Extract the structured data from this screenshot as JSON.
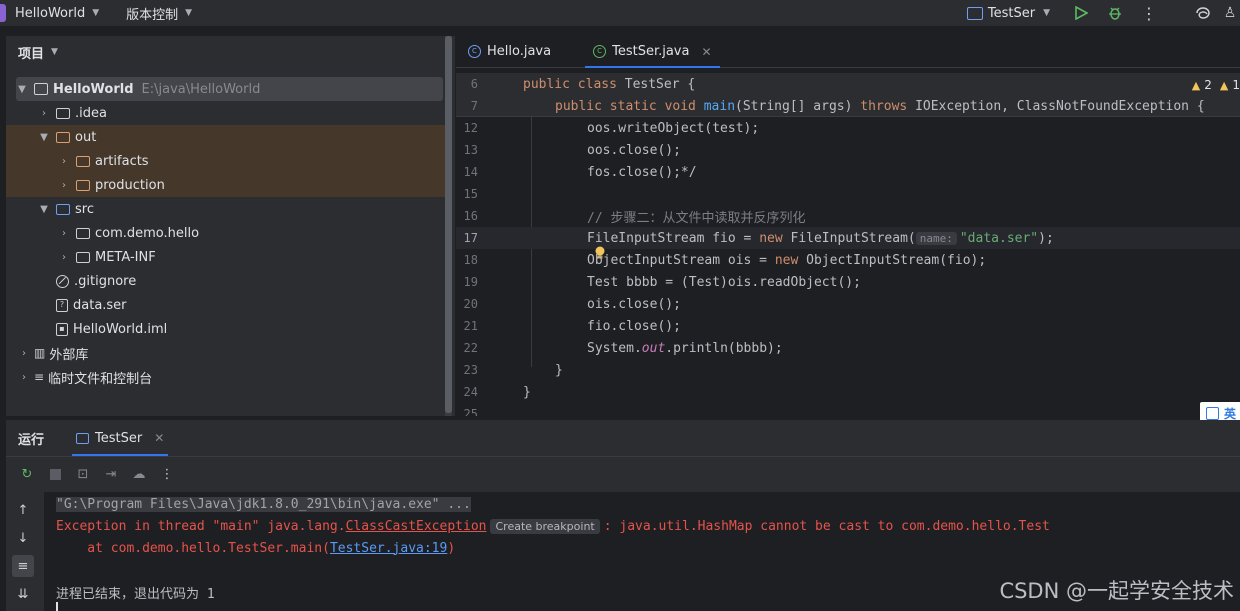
{
  "titlebar": {
    "project_name": "HelloWorld",
    "vcs_menu": "版本控制",
    "run_config": "TestSer"
  },
  "project": {
    "header": "项目",
    "tree": [
      {
        "label": "HelloWorld",
        "path": "E:\\java\\HelloWorld",
        "depth": 0,
        "expanded": true,
        "icon": "module-icon"
      },
      {
        "label": ".idea",
        "depth": 1,
        "expanded": false,
        "icon": "folder-icon"
      },
      {
        "label": "out",
        "depth": 1,
        "expanded": true,
        "icon": "folder-icon"
      },
      {
        "label": "artifacts",
        "depth": 2,
        "expanded": false,
        "icon": "folder-icon"
      },
      {
        "label": "production",
        "depth": 2,
        "expanded": false,
        "icon": "folder-icon"
      },
      {
        "label": "src",
        "depth": 1,
        "expanded": true,
        "icon": "source-folder-icon"
      },
      {
        "label": "com.demo.hello",
        "depth": 2,
        "expanded": false,
        "icon": "package-icon"
      },
      {
        "label": "META-INF",
        "depth": 2,
        "expanded": false,
        "icon": "folder-icon"
      },
      {
        "label": ".gitignore",
        "depth": 1,
        "icon": "ignore-file-icon"
      },
      {
        "label": "data.ser",
        "depth": 1,
        "icon": "unknown-file-icon"
      },
      {
        "label": "HelloWorld.iml",
        "depth": 1,
        "icon": "iml-file-icon"
      },
      {
        "label": "外部库",
        "depth": 0,
        "expanded": false,
        "icon": "library-icon"
      },
      {
        "label": "临时文件和控制台",
        "depth": 0,
        "expanded": false,
        "icon": "scratch-icon"
      }
    ]
  },
  "editor": {
    "tabs": [
      {
        "label": "Hello.java",
        "active": false
      },
      {
        "label": "TestSer.java",
        "active": true
      }
    ],
    "warnings": {
      "count_a": "2",
      "count_b": "1"
    },
    "line_numbers": {
      "l6": "6",
      "l7": "7",
      "l12": "12",
      "l13": "13",
      "l14": "14",
      "l15": "15",
      "l16": "16",
      "l17": "17",
      "l18": "18",
      "l19": "19",
      "l20": "20",
      "l21": "21",
      "l22": "22",
      "l23": "23",
      "l24": "24",
      "l25": "25"
    },
    "code": {
      "l6_kw": "public class ",
      "l6_rest": "TestSer {",
      "l7_kw1": "public static void ",
      "l7_fn": "main",
      "l7_mid": "(String[] args) ",
      "l7_kw2": "throws ",
      "l7_rest": "IOException, ClassNotFoundException {",
      "l12": "oos.writeObject(test);",
      "l13": "oos.close();",
      "l14": "fos.close();*/",
      "l16": "// 步骤二：从文件中读取并反序列化",
      "l17_a": "FileInputStream fio = ",
      "l17_kw": "new ",
      "l17_b": "FileInputStream(",
      "l17_hint": "name:",
      "l17_str": "\"data.ser\"",
      "l17_c": ");",
      "l18_a": "ObjectInputStream ois = ",
      "l18_kw": "new ",
      "l18_b": "ObjectInputStream(fio);",
      "l19": "Test bbbb = (Test)ois.readObject();",
      "l20": "ois.close();",
      "l21": "fio.close();",
      "l22_a": "System.",
      "l22_fld": "out",
      "l22_b": ".println(bbbb);",
      "l23": "}",
      "l24": "}"
    }
  },
  "float_widget": {
    "label": "英"
  },
  "run": {
    "title": "运行",
    "tab": "TestSer",
    "console": {
      "cmd": "\"G:\\Program Files\\Java\\jdk1.8.0_291\\bin\\java.exe\" ...",
      "err_prefix": "Exception in thread \"main\" java.lang.",
      "err_class": "ClassCastException",
      "breakpoint_chip": "Create breakpoint",
      "err_suffix": ": java.util.HashMap cannot be cast to com.demo.hello.Test",
      "at_prefix": "    at com.demo.hello.TestSer.main(",
      "at_link": "TestSer.java:19",
      "at_suffix": ")",
      "exit": "进程已结束，退出代码为 1"
    }
  },
  "watermark": "CSDN @一起学安全技术",
  "colors": {
    "accent": "#3574f0",
    "error": "#e5534b",
    "keyword": "#cf8e6d",
    "string": "#6aab73",
    "excluded_bg": "#45382a"
  }
}
